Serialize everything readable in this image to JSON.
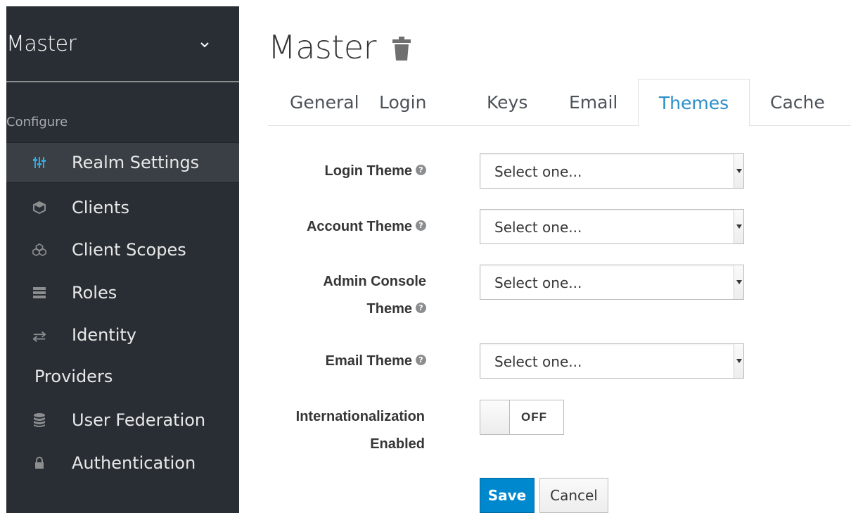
{
  "sidebar": {
    "realm_name": "Master",
    "section_label": "Configure",
    "items": [
      {
        "label": "Realm Settings",
        "icon": "sliders-icon",
        "active": true
      },
      {
        "label": "Clients",
        "icon": "cube-icon"
      },
      {
        "label": "Client Scopes",
        "icon": "cubes-icon"
      },
      {
        "label": "Roles",
        "icon": "list-icon"
      },
      {
        "label": "Identity",
        "label_line2": "Providers",
        "icon": "exchange-icon"
      },
      {
        "label": "User Federation",
        "icon": "database-icon"
      },
      {
        "label": "Authentication",
        "icon": "lock-icon"
      }
    ]
  },
  "header": {
    "title": "Master",
    "delete_icon": "trash-icon"
  },
  "tabs": [
    {
      "label": "General"
    },
    {
      "label": "Login"
    },
    {
      "label": "Keys"
    },
    {
      "label": "Email"
    },
    {
      "label": "Themes",
      "active": true
    },
    {
      "label": "Cache"
    }
  ],
  "form": {
    "login_theme": {
      "label": "Login Theme",
      "value": "Select one..."
    },
    "account_theme": {
      "label": "Account Theme",
      "value": "Select one..."
    },
    "admin_console_theme": {
      "label_line1": "Admin Console",
      "label_line2": "Theme",
      "value": "Select one..."
    },
    "email_theme": {
      "label": "Email Theme",
      "value": "Select one..."
    },
    "internationalization": {
      "label_line1": "Internationalization",
      "label_line2": "Enabled",
      "state": "OFF"
    },
    "help_glyph": "?"
  },
  "buttons": {
    "save": "Save",
    "cancel": "Cancel"
  },
  "colors": {
    "sidebar_bg": "#292e34",
    "sidebar_active": "#393f44",
    "accent": "#0088ce",
    "tab_active_text": "#2a8fc7"
  }
}
